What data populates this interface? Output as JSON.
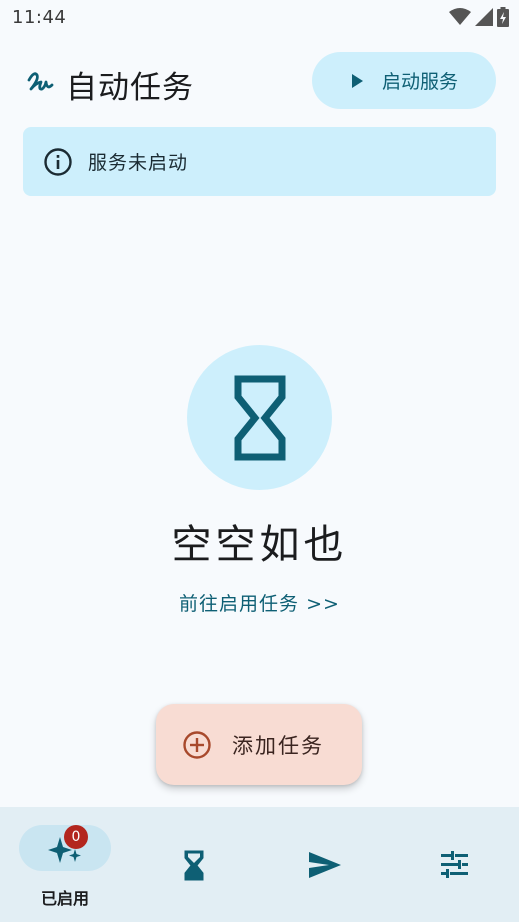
{
  "status_bar": {
    "time": "11:44"
  },
  "header": {
    "title": "自动任务",
    "start_button_label": "启动服务"
  },
  "banner": {
    "text": "服务未启动"
  },
  "empty_state": {
    "title": "空空如也",
    "link": "前往启用任务 >>"
  },
  "fab": {
    "label": "添加任务"
  },
  "bottom_nav": {
    "items": [
      {
        "icon": "sparkle-icon",
        "label": "已启用",
        "badge": "0",
        "selected": true
      },
      {
        "icon": "hourglass-icon",
        "label": ""
      },
      {
        "icon": "send-icon",
        "label": ""
      },
      {
        "icon": "tune-icon",
        "label": ""
      }
    ]
  },
  "colors": {
    "accent": "#0e5f74",
    "container": "#cdeffc",
    "fab": "#f8dcd3",
    "badge": "#b3261e"
  }
}
